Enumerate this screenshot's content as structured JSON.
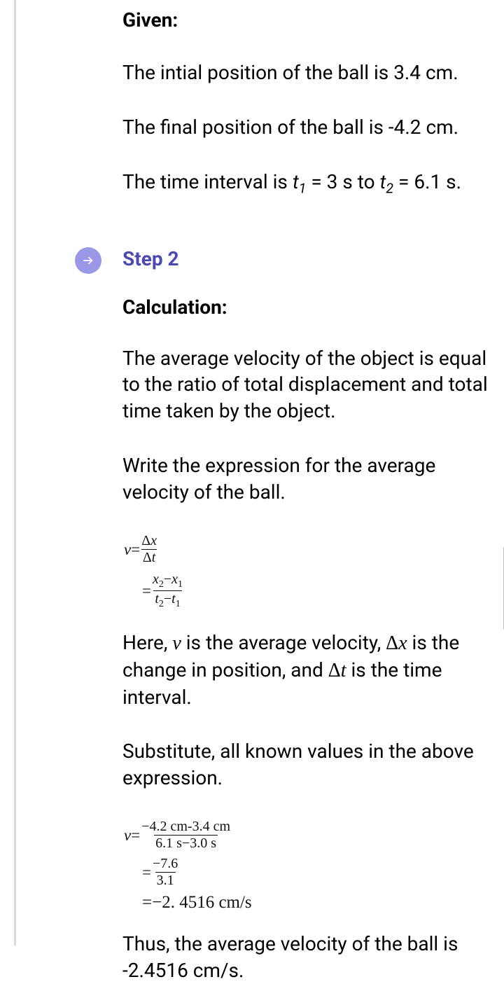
{
  "given": {
    "heading": "Given:",
    "line1": "The intial position of the ball is 3.4 cm.",
    "line2": "The final position of the ball is -4.2 cm.",
    "time_prefix": "The time interval is ",
    "t1_sym": "t",
    "t1_sub": "1",
    "t1_eq": " = 3 s to ",
    "t2_sym": "t",
    "t2_sub": "2",
    "t2_eq": " = 6.1 s."
  },
  "step2": {
    "label": "Step 2"
  },
  "calc": {
    "heading": "Calculation:",
    "def": "The average velocity of the object is equal to the ratio of total displacement and total time taken by the object.",
    "instr": "Write the expression for the average velocity of the ball."
  },
  "eq1": {
    "v": "v",
    "eq": "=",
    "dx": "Δx",
    "dt": "Δt",
    "x2mx1": "x₂−x₁",
    "t2mt1": "t₂−t₁",
    "x2": "x",
    "x2s": "2",
    "x1": "x",
    "x1s": "1",
    "t2": "t",
    "t2s": "2",
    "t1": "t",
    "t1s": "1",
    "minus": "−"
  },
  "desc": {
    "prefix": "Here, ",
    "v": "v",
    "mid1": " is the average velocity, ",
    "dx": "Δx",
    "mid2": " is the change in position, and ",
    "dt": "Δt",
    "mid3": " is the time interval."
  },
  "subst": "Substitute, all known values in the above expression.",
  "eq2": {
    "num1": "−4.2 cm-3.4 cm",
    "den1": "6.1 s−3.0 s",
    "num2": "−7.6",
    "den2": "3.1",
    "result": "=−2. 4516 cm/s"
  },
  "conclusion": "Thus, the average velocity of the ball is -2.4516 cm/s."
}
